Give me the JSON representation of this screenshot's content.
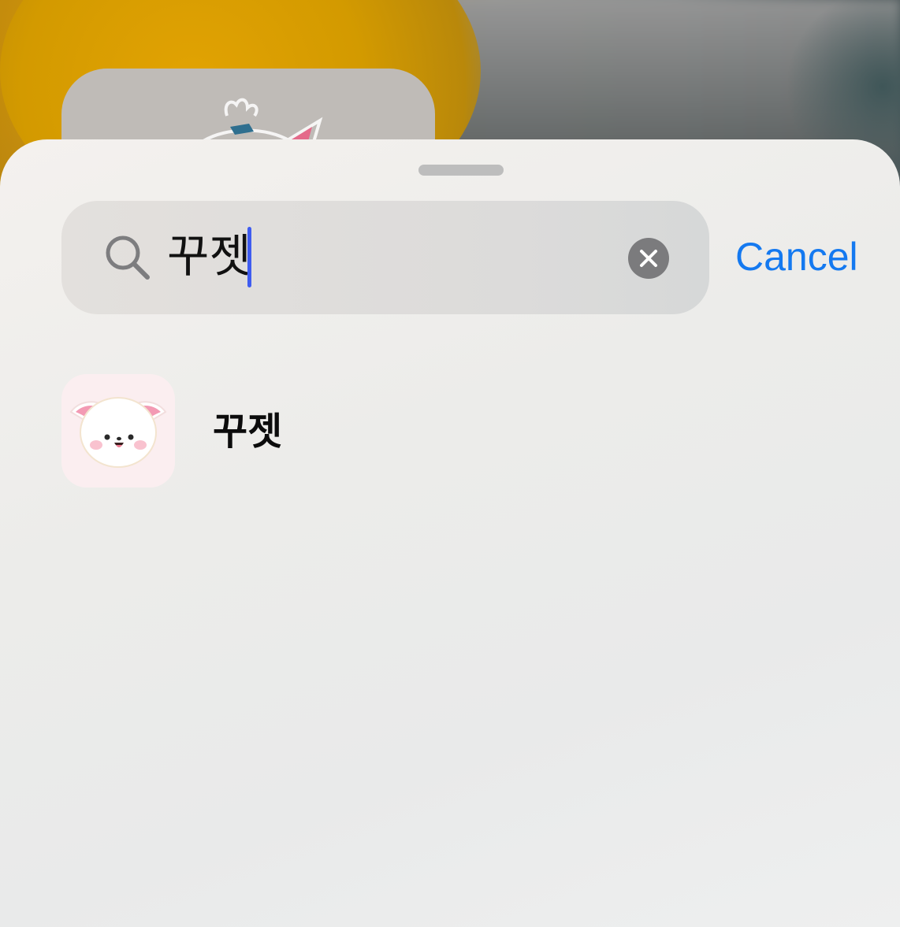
{
  "search": {
    "query": "꾸젯",
    "icon": "magnifying-glass-icon",
    "clear_icon": "close-icon",
    "cancel_label": "Cancel"
  },
  "results": [
    {
      "label": "꾸젯",
      "icon": "bunny-mascot-app-icon"
    }
  ],
  "colors": {
    "accent": "#1479f0",
    "caret": "#3f5cf0",
    "clear_button": "#7b7b7d",
    "app_icon_bg": "#fbeef0"
  }
}
